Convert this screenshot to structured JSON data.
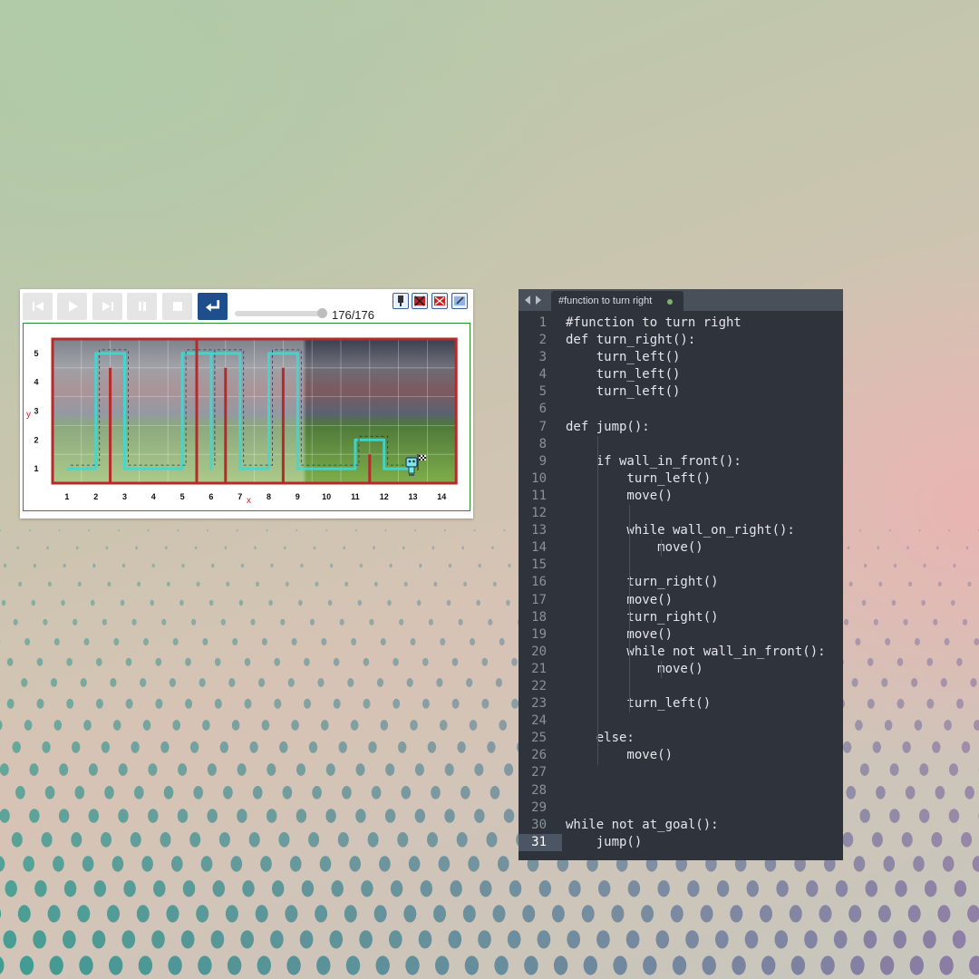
{
  "world": {
    "controls": [
      {
        "name": "reverse-step-button",
        "icon": "skip-back-icon",
        "enabled": false
      },
      {
        "name": "play-button",
        "icon": "play-icon",
        "enabled": false
      },
      {
        "name": "step-button",
        "icon": "skip-forward-icon",
        "enabled": false
      },
      {
        "name": "pause-button",
        "icon": "pause-icon",
        "enabled": false
      },
      {
        "name": "stop-button",
        "icon": "stop-icon",
        "enabled": false
      },
      {
        "name": "reload-button",
        "icon": "return-icon",
        "enabled": true
      }
    ],
    "progress": 1.0,
    "step_counter": "176/176",
    "tool_icons": [
      "highlight-icon",
      "delete-world-icon",
      "world-info-icon",
      "edit-world-icon"
    ],
    "x_axis_label": "x",
    "y_axis_label": "y",
    "x_ticks": [
      "1",
      "2",
      "3",
      "4",
      "5",
      "6",
      "7",
      "8",
      "9",
      "10",
      "11",
      "12",
      "13",
      "14"
    ],
    "y_ticks": [
      "1",
      "2",
      "3",
      "4",
      "5"
    ],
    "wall_color": "#b52a2a",
    "trace_color": "#3fd9d2",
    "goal_icon": "checkered-flag-icon",
    "robot_icon": "robot-icon"
  },
  "editor": {
    "nav_icons": [
      "chevron-left-icon",
      "chevron-right-icon"
    ],
    "tab_title": "#function to turn right",
    "tab_modified_color": "#7fb36a",
    "current_line": 31,
    "lines": [
      {
        "n": "1",
        "text": "#function to turn right"
      },
      {
        "n": "2",
        "text": "def turn_right():"
      },
      {
        "n": "3",
        "text": "    turn_left()"
      },
      {
        "n": "4",
        "text": "    turn_left()"
      },
      {
        "n": "5",
        "text": "    turn_left()"
      },
      {
        "n": "6",
        "text": ""
      },
      {
        "n": "7",
        "text": "def jump():"
      },
      {
        "n": "8",
        "text": ""
      },
      {
        "n": "9",
        "text": "    if wall_in_front():"
      },
      {
        "n": "10",
        "text": "        turn_left()"
      },
      {
        "n": "11",
        "text": "        move()"
      },
      {
        "n": "12",
        "text": ""
      },
      {
        "n": "13",
        "text": "        while wall_on_right():"
      },
      {
        "n": "14",
        "text": "            move()"
      },
      {
        "n": "15",
        "text": ""
      },
      {
        "n": "16",
        "text": "        turn_right()"
      },
      {
        "n": "17",
        "text": "        move()"
      },
      {
        "n": "18",
        "text": "        turn_right()"
      },
      {
        "n": "19",
        "text": "        move()"
      },
      {
        "n": "20",
        "text": "        while not wall_in_front():"
      },
      {
        "n": "21",
        "text": "            move()"
      },
      {
        "n": "22",
        "text": ""
      },
      {
        "n": "23",
        "text": "        turn_left()"
      },
      {
        "n": "24",
        "text": ""
      },
      {
        "n": "25",
        "text": "    else:"
      },
      {
        "n": "26",
        "text": "        move()"
      },
      {
        "n": "27",
        "text": ""
      },
      {
        "n": "28",
        "text": ""
      },
      {
        "n": "29",
        "text": ""
      },
      {
        "n": "30",
        "text": "while not at_goal():"
      },
      {
        "n": "31",
        "text": "    jump()"
      }
    ]
  }
}
